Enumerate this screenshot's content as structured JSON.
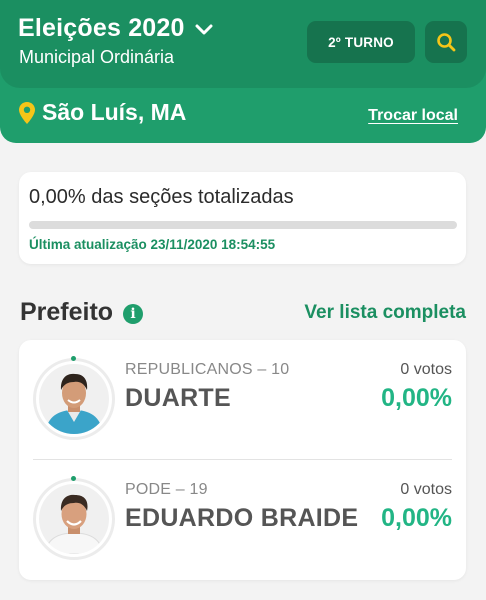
{
  "header": {
    "title": "Eleições 2020",
    "subtitle": "Municipal Ordinária",
    "turno_button": "2º TURNO",
    "search_icon": "search-icon",
    "location": "São Luís, MA",
    "change_location": "Trocar local"
  },
  "progress": {
    "title": "0,00% das seções totalizadas",
    "fraction": 0,
    "updated": "Última atualização 23/11/2020 18:54:55"
  },
  "section": {
    "title": "Prefeito",
    "info_icon": "i",
    "see_full_list": "Ver lista completa"
  },
  "candidates": [
    {
      "party": "REPUBLICANOS – 10",
      "name": "DUARTE",
      "votes": "0 votos",
      "percent": "0,00%"
    },
    {
      "party": "PODE – 19",
      "name": "EDUARDO BRAIDE",
      "votes": "0 votos",
      "percent": "0,00%"
    }
  ],
  "colors": {
    "brand_green": "#1f9e6c",
    "dark_green": "#16734e",
    "accent_yellow": "#f5c518",
    "percent_green": "#22b585"
  }
}
